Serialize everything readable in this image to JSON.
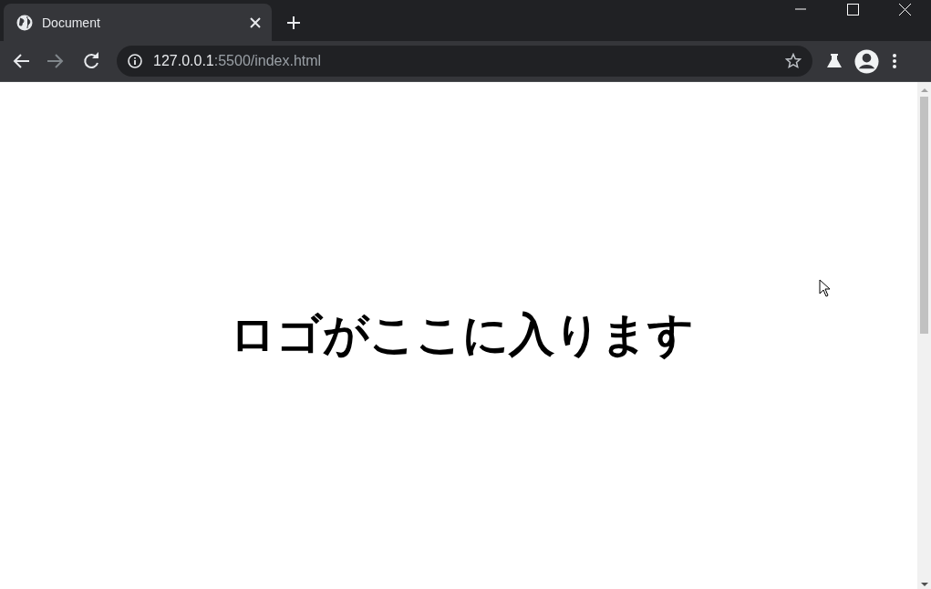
{
  "tabs": [
    {
      "title": "Document",
      "selected": true
    }
  ],
  "address_bar": {
    "host": "127.0.0.1",
    "path": ":5500/index.html"
  },
  "page": {
    "heading": "ロゴがここに入ります"
  }
}
